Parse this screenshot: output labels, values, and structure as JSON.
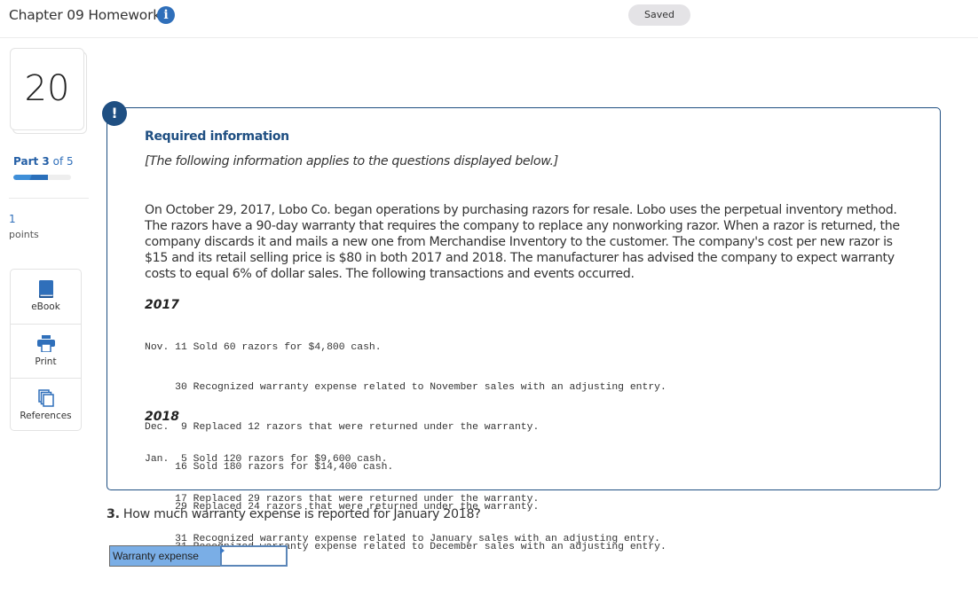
{
  "header": {
    "title": "Chapter 09 Homework",
    "info_icon": "info-icon",
    "saved_status": "Saved"
  },
  "sidebar": {
    "question_number": "20",
    "part": {
      "prefix": "Part",
      "current": "3",
      "of_text": "of 5",
      "current_value": 3,
      "total": 5,
      "progress_fraction": 0.6
    },
    "points": {
      "value": "1",
      "label": "points"
    },
    "tools": [
      {
        "label": "eBook",
        "icon": "book-icon"
      },
      {
        "label": "Print",
        "icon": "printer-icon"
      },
      {
        "label": "References",
        "icon": "copy-documents-icon"
      }
    ]
  },
  "info_box": {
    "alert_icon": "!",
    "title": "Required information",
    "subtitle": "[The following information applies to the questions displayed below.]",
    "paragraph": "On October 29, 2017, Lobo Co. began operations by purchasing razors for resale. Lobo uses the perpetual inventory method. The razors have a 90-day warranty that requires the company to replace any nonworking razor. When a razor is returned, the company discards it and mails a new one from Merchandise Inventory to the customer. The company's cost per new razor is $15 and its retail selling price is $80 in both 2017 and 2018. The manufacturer has advised the company to expect warranty costs to equal 6% of dollar sales. The following transactions and events occurred.",
    "years": [
      {
        "year": "2017",
        "lines": [
          "Nov. 11 Sold 60 razors for $4,800 cash.",
          "     30 Recognized warranty expense related to November sales with an adjusting entry.",
          "Dec.  9 Replaced 12 razors that were returned under the warranty.",
          "     16 Sold 180 razors for $14,400 cash.",
          "     29 Replaced 24 razors that were returned under the warranty.",
          "     31 Recognized warranty expense related to December sales with an adjusting entry."
        ]
      },
      {
        "year": "2018",
        "lines": [
          "Jan.  5 Sold 120 razors for $9,600 cash.",
          "     17 Replaced 29 razors that were returned under the warranty.",
          "     31 Recognized warranty expense related to January sales with an adjusting entry."
        ]
      }
    ]
  },
  "question": {
    "number": "3.",
    "text": " How much warranty expense is reported for January 2018?",
    "answer_label": "Warranty expense",
    "answer_value": ""
  },
  "colors": {
    "brand_blue": "#2f6fba",
    "box_border": "#1f4f82",
    "answer_label_bg": "#7aaee6"
  }
}
